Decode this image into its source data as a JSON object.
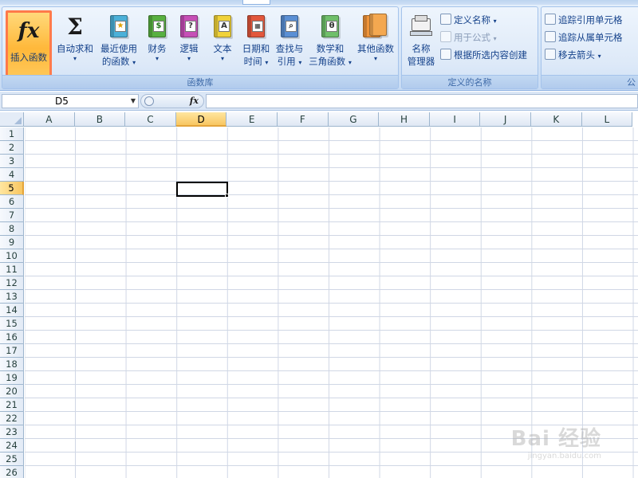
{
  "ribbon": {
    "tabs": [
      "...",
      "...",
      "...",
      "...",
      "...",
      "...",
      "...",
      "..."
    ],
    "function_library": {
      "group_label": "函数库",
      "insert_function": {
        "icon": "fx",
        "label": "插入函数"
      },
      "autosum": {
        "icon": "Σ",
        "label": "自动求和"
      },
      "recent": {
        "label1": "最近使用",
        "label2": "的函数"
      },
      "financial": {
        "label": "财务"
      },
      "logical": {
        "label": "逻辑"
      },
      "text": {
        "label": "文本"
      },
      "datetime": {
        "label1": "日期和",
        "label2": "时间"
      },
      "lookup": {
        "label1": "查找与",
        "label2": "引用"
      },
      "math": {
        "label1": "数学和",
        "label2": "三角函数"
      },
      "more": {
        "label": "其他函数"
      }
    },
    "defined_names": {
      "group_label": "定义的名称",
      "name_manager": {
        "label1": "名称",
        "label2": "管理器"
      },
      "define_name": "定义名称",
      "use_in_formula": "用于公式",
      "create_from_selection": "根据所选内容创建"
    },
    "formula_auditing": {
      "group_label": "公",
      "trace_precedents": "追踪引用单元格",
      "trace_dependents": "追踪从属单元格",
      "remove_arrows": "移去箭头"
    },
    "colors": {
      "accent_highlight": "#ff7a4a",
      "ribbon_text": "#15428b"
    }
  },
  "formula_bar": {
    "name_box": "D5",
    "fx_label": "fx",
    "content": ""
  },
  "sheet": {
    "columns": [
      "A",
      "B",
      "C",
      "D",
      "E",
      "F",
      "G",
      "H",
      "I",
      "J",
      "K",
      "L"
    ],
    "rows": [
      "1",
      "2",
      "3",
      "4",
      "5",
      "6",
      "7",
      "8",
      "9",
      "10",
      "11",
      "12",
      "13",
      "14",
      "15",
      "16",
      "17",
      "18",
      "19",
      "20",
      "21",
      "22",
      "23",
      "24",
      "25",
      "26"
    ],
    "selected_column": "D",
    "selected_row": "5"
  },
  "watermark": {
    "main": "Bai 经验",
    "sub": "jingyan.baidu.com"
  }
}
